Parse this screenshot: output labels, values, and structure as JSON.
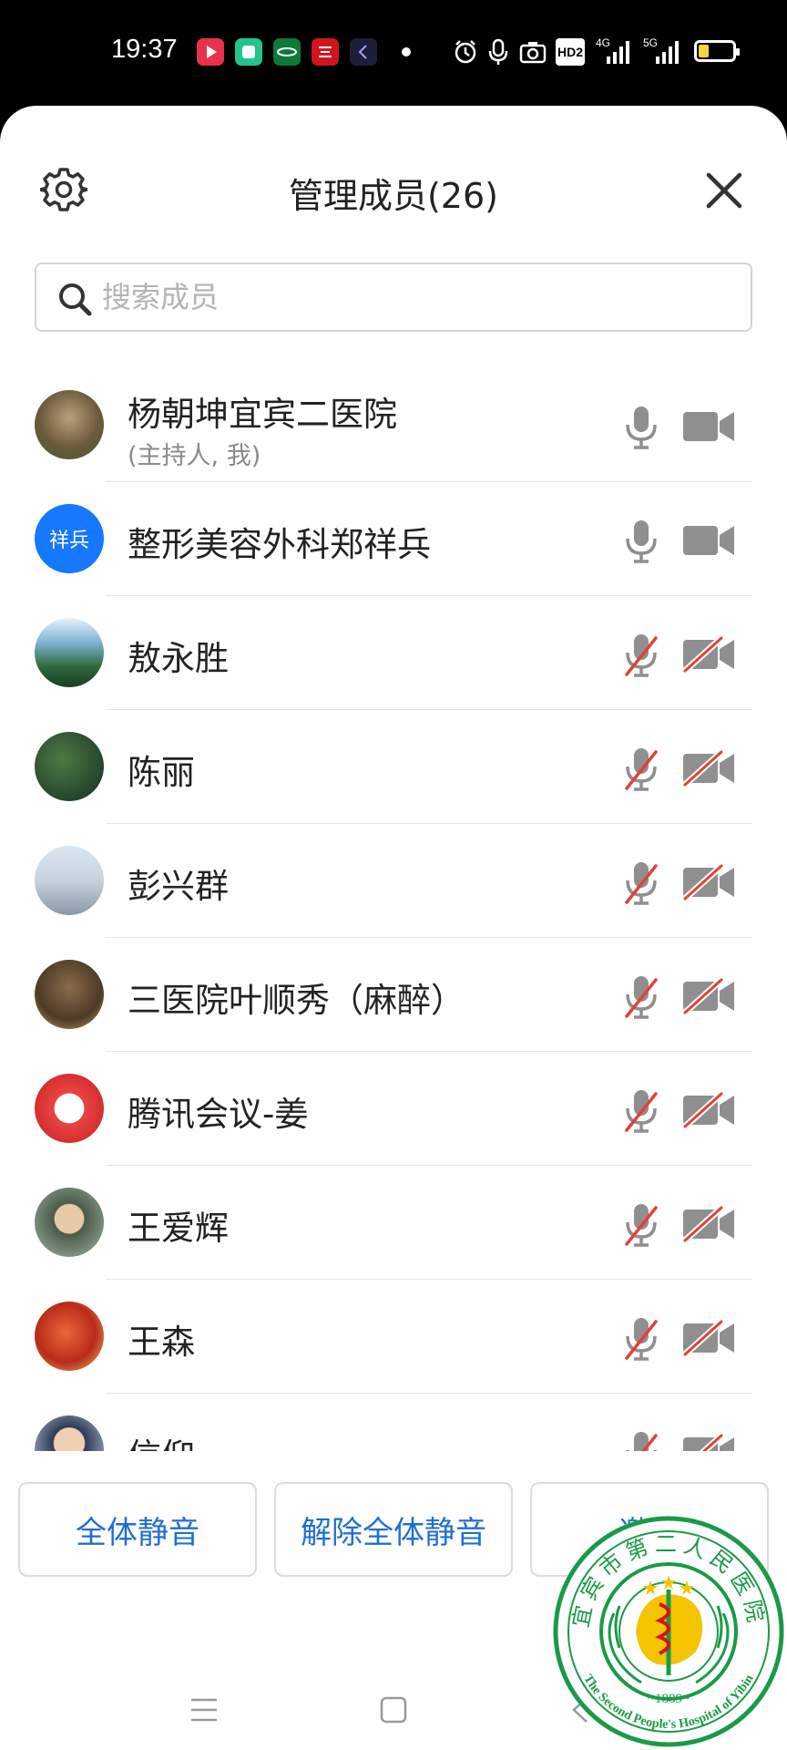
{
  "status_bar": {
    "time": "19:37",
    "network_1": "4G",
    "network_2": "5G",
    "hd_badge": "HD2",
    "battery_level": 0.3
  },
  "header": {
    "title": "管理成员(26)",
    "settings_icon": "gear-icon",
    "close_icon": "close-icon"
  },
  "search": {
    "placeholder": "搜索成员"
  },
  "members": [
    {
      "name": "杨朝坤宜宾二医院",
      "subtitle": "(主持人, 我)",
      "mic_muted": false,
      "cam_off": false
    },
    {
      "name": "整形美容外科郑祥兵",
      "avatar_text": "祥兵",
      "mic_muted": false,
      "cam_off": false
    },
    {
      "name": "敖永胜",
      "mic_muted": true,
      "cam_off": true
    },
    {
      "name": "陈丽",
      "mic_muted": true,
      "cam_off": true
    },
    {
      "name": "彭兴群",
      "mic_muted": true,
      "cam_off": true
    },
    {
      "name": "三医院叶顺秀（麻醉）",
      "mic_muted": true,
      "cam_off": true
    },
    {
      "name": "腾讯会议-姜",
      "mic_muted": true,
      "cam_off": true
    },
    {
      "name": "王爱辉",
      "mic_muted": true,
      "cam_off": true
    },
    {
      "name": "王森",
      "mic_muted": true,
      "cam_off": true
    },
    {
      "name": "信仰",
      "mic_muted": true,
      "cam_off": true
    }
  ],
  "actions": {
    "mute_all": "全体静音",
    "unmute_all": "解除全体静音",
    "invite": "邀请"
  },
  "seal": {
    "text_top": "宜宾市第二人民医院",
    "text_bottom": "The Second People's Hospital of Yibin",
    "year": "~1889~"
  },
  "colors": {
    "accent": "#1f6fd1",
    "muted_slash": "#e0423a",
    "icon_gray": "#8f8f8f",
    "seal_green": "#1a9a48",
    "seal_yellow": "#f5c400"
  }
}
